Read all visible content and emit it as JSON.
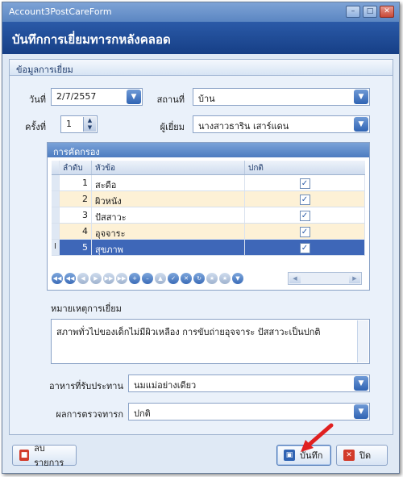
{
  "window": {
    "title": "Account3PostCareForm"
  },
  "header": {
    "title": "บันทึกการเยี่ยมทารกหลังคลอด"
  },
  "group": {
    "caption": "ข้อมูลการเยี่ยม"
  },
  "form": {
    "date_label": "วันที่",
    "date_value": "2/7/2557",
    "place_label": "สถานที่",
    "place_value": "บ้าน",
    "visit_no_label": "ครั้งที่",
    "visit_no_value": "1",
    "visitor_label": "ผู้เยี่ยม",
    "visitor_value": "นางสาวธาริน  เสาร์แดน"
  },
  "screening": {
    "caption": "การคัดกรอง",
    "columns": [
      "ลำดับ",
      "หัวข้อ",
      "ปกติ"
    ],
    "rows": [
      {
        "no": "1",
        "topic": "สะดือ",
        "normal": true
      },
      {
        "no": "2",
        "topic": "ผิวหนัง",
        "normal": true
      },
      {
        "no": "3",
        "topic": "ปัสสาวะ",
        "normal": true
      },
      {
        "no": "4",
        "topic": "อุจจาระ",
        "normal": true
      },
      {
        "no": "5",
        "topic": "สุขภาพ",
        "normal": true
      }
    ],
    "selected_indicator": "I"
  },
  "note": {
    "label": "หมายเหตุการเยี่ยม",
    "value": "สภาพทั่วไปของเด็กไม่มีผิวเหลือง การขับถ่ายอุจจาระ ปัสสาวะเป็นปกติ"
  },
  "feeding": {
    "label": "อาหารที่รับประทาน",
    "value": "นมแม่อย่างเดียว"
  },
  "exam": {
    "label": "ผลการตรวจทารก",
    "value": "ปกติ"
  },
  "buttons": {
    "delete_label": "ลบรายการ",
    "save_label": "บันทึก",
    "close_label": "ปิด"
  },
  "colors": {
    "header": "#163f86",
    "selection": "#3e67b8",
    "alt_row": "#fdf1d6",
    "arrow": "#e02020"
  }
}
